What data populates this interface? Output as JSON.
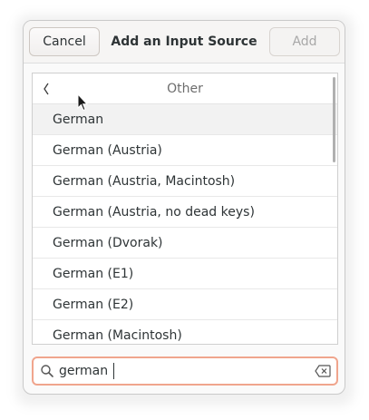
{
  "header": {
    "cancel_label": "Cancel",
    "title": "Add an Input Source",
    "add_label": "Add"
  },
  "list": {
    "back_icon": "chevron-left-icon",
    "section_title": "Other",
    "items": [
      {
        "label": "German",
        "selected": true
      },
      {
        "label": "German (Austria)",
        "selected": false
      },
      {
        "label": "German (Austria, Macintosh)",
        "selected": false
      },
      {
        "label": "German (Austria, no dead keys)",
        "selected": false
      },
      {
        "label": "German (Dvorak)",
        "selected": false
      },
      {
        "label": "German (E1)",
        "selected": false
      },
      {
        "label": "German (E2)",
        "selected": false
      },
      {
        "label": "German (Macintosh)",
        "selected": false
      }
    ]
  },
  "search": {
    "value": "german",
    "icon": "search-icon",
    "clear_icon": "clear-text-icon"
  },
  "colors": {
    "focus_border": "#f0a58d",
    "selected_row": "#f2f2f2",
    "disabled_text": "#a8a8a8"
  }
}
